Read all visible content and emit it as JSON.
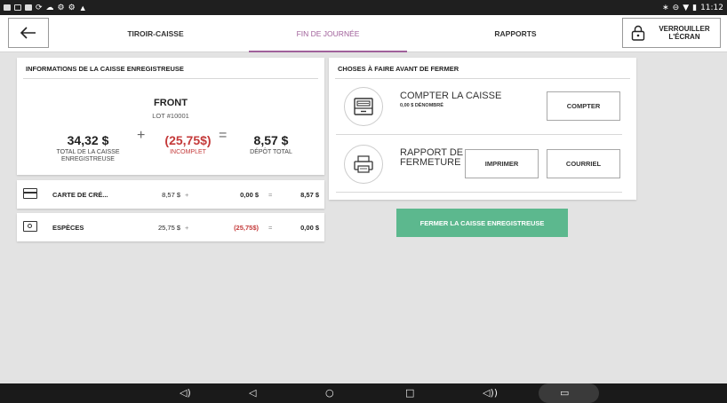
{
  "status_bar": {
    "time": "11:12"
  },
  "nav": {
    "tab_drawer": "TIROIR-CAISSE",
    "tab_eod": "FIN DE JOURNÉE",
    "tab_reports": "RAPPORTS",
    "lock_line1": "VERROUILLER",
    "lock_line2": "L'ÉCRAN"
  },
  "info": {
    "title": "INFORMATIONS DE LA CAISSE ENREGISTREUSE",
    "register_name": "FRONT",
    "lot": "LOT #10001",
    "total_amount": "34,32 $",
    "total_label1": "TOTAL DE LA CAISSE",
    "total_label2": "ENREGISTREUSE",
    "plus": "+",
    "incomplete_amount": "(25,75$)",
    "incomplete_label": "INCOMPLET",
    "equals": "=",
    "deposit_amount": "8,57 $",
    "deposit_label": "DÉPÔT TOTAL"
  },
  "payments": [
    {
      "name": "CARTE DE CRÉ...",
      "a": "8,57 $",
      "op1": "+",
      "b": "0,00 $",
      "op2": "=",
      "c": "8,57 $"
    },
    {
      "name": "ESPÈCES",
      "a": "25,75 $",
      "op1": "+",
      "b": "(25,75$)",
      "op2": "=",
      "c": "0,00 $"
    }
  ],
  "todo": {
    "title": "CHOSES À FAIRE AVANT DE FERMER",
    "count_title": "COMPTER LA CAISSE",
    "count_sub": "0,00 $ DÉNOMBRÉ",
    "count_button": "COMPTER",
    "report_title1": "RAPPORT DE",
    "report_title2": "FERMETURE",
    "print_button": "IMPRIMER",
    "email_button": "COURRIEL"
  },
  "close_button": "FERMER LA CAISSE ENREGISTREUSE",
  "colors": {
    "accent": "#a0609a",
    "negative": "#c43a3a",
    "primary_button": "#5cb88e"
  }
}
